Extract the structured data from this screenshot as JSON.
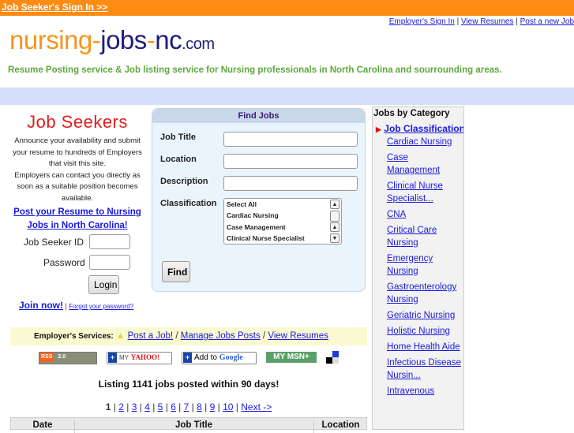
{
  "topbar": {
    "signin_link": "Job Seeker's Sign In >>"
  },
  "toplinks": [
    "Employer's Sign In",
    "View Resumes",
    "Post a new Job"
  ],
  "logo": {
    "part1": "nursing",
    "dash1": "-",
    "part2": "jobs",
    "dash2": "-",
    "part3": "nc",
    "dot": ".",
    "tld": "com"
  },
  "tagline": "Resume Posting service & Job listing service for Nursing professionals in North Carolina and sourrounding areas.",
  "seekers": {
    "title": "Job Seekers",
    "text1": "Announce your availability and submit your resume to hundreds of Employers that visit this site.",
    "text2": "Employers can contact you directly as soon as a suitable position becomes available.",
    "post_link": "Post your Resume to Nursing Jobs in North Carolina!",
    "id_label": "Job Seeker ID",
    "id_value": "",
    "password_label": "Password",
    "password_value": "",
    "login_button": "Login",
    "join_link": "Join now!",
    "separator": "|",
    "forgot_link": "Forgot your password?"
  },
  "find": {
    "title": "Find Jobs",
    "job_title_label": "Job Title",
    "job_title_value": "",
    "location_label": "Location",
    "location_value": "",
    "description_label": "Description",
    "description_value": "",
    "classification_label": "Classification",
    "classification_options": [
      "Select All",
      "Cardiac Nursing",
      "Case Management",
      "Clinical Nurse Specialist"
    ],
    "find_button": "Find"
  },
  "categories": {
    "title": "Jobs by Category",
    "heading_link": "Job Classification",
    "items": [
      "Cardiac Nursing",
      "Case Management",
      "Clinical Nurse Specialist...",
      "CNA",
      "Critical Care Nursing",
      "Emergency Nursing",
      "Gastroenterology Nursing",
      "Geriatric Nursing",
      "Holistic Nursing",
      "Home Health Aide",
      "Infectious Disease Nursin...",
      "Intravenous"
    ]
  },
  "employer_services": {
    "label": "Employer's Services:",
    "links": [
      "Post a Job!",
      "Manage Jobs Posts",
      "View Resumes"
    ],
    "separator": "/"
  },
  "badges": {
    "rss": "RSS",
    "rss_version": "2.0",
    "yahoo_my": "MY",
    "yahoo": "YAHOO!",
    "google_add": "Add to",
    "google": "Google",
    "msn": "MY MSN+",
    "plus": "+"
  },
  "listing": "Listing 1141 jobs posted within 90 days!",
  "pager": {
    "current": "1",
    "pages": [
      "2",
      "3",
      "4",
      "5",
      "6",
      "7",
      "8",
      "9",
      "10"
    ],
    "next": "Next ->"
  },
  "table": {
    "headers": [
      "Date",
      "Job Title",
      "Location"
    ]
  },
  "colors": {
    "orange": "#fd8b14",
    "navy": "#1e1e7a",
    "green": "#5fa83c",
    "link": "#1a1adf",
    "red": "#e0201e"
  }
}
